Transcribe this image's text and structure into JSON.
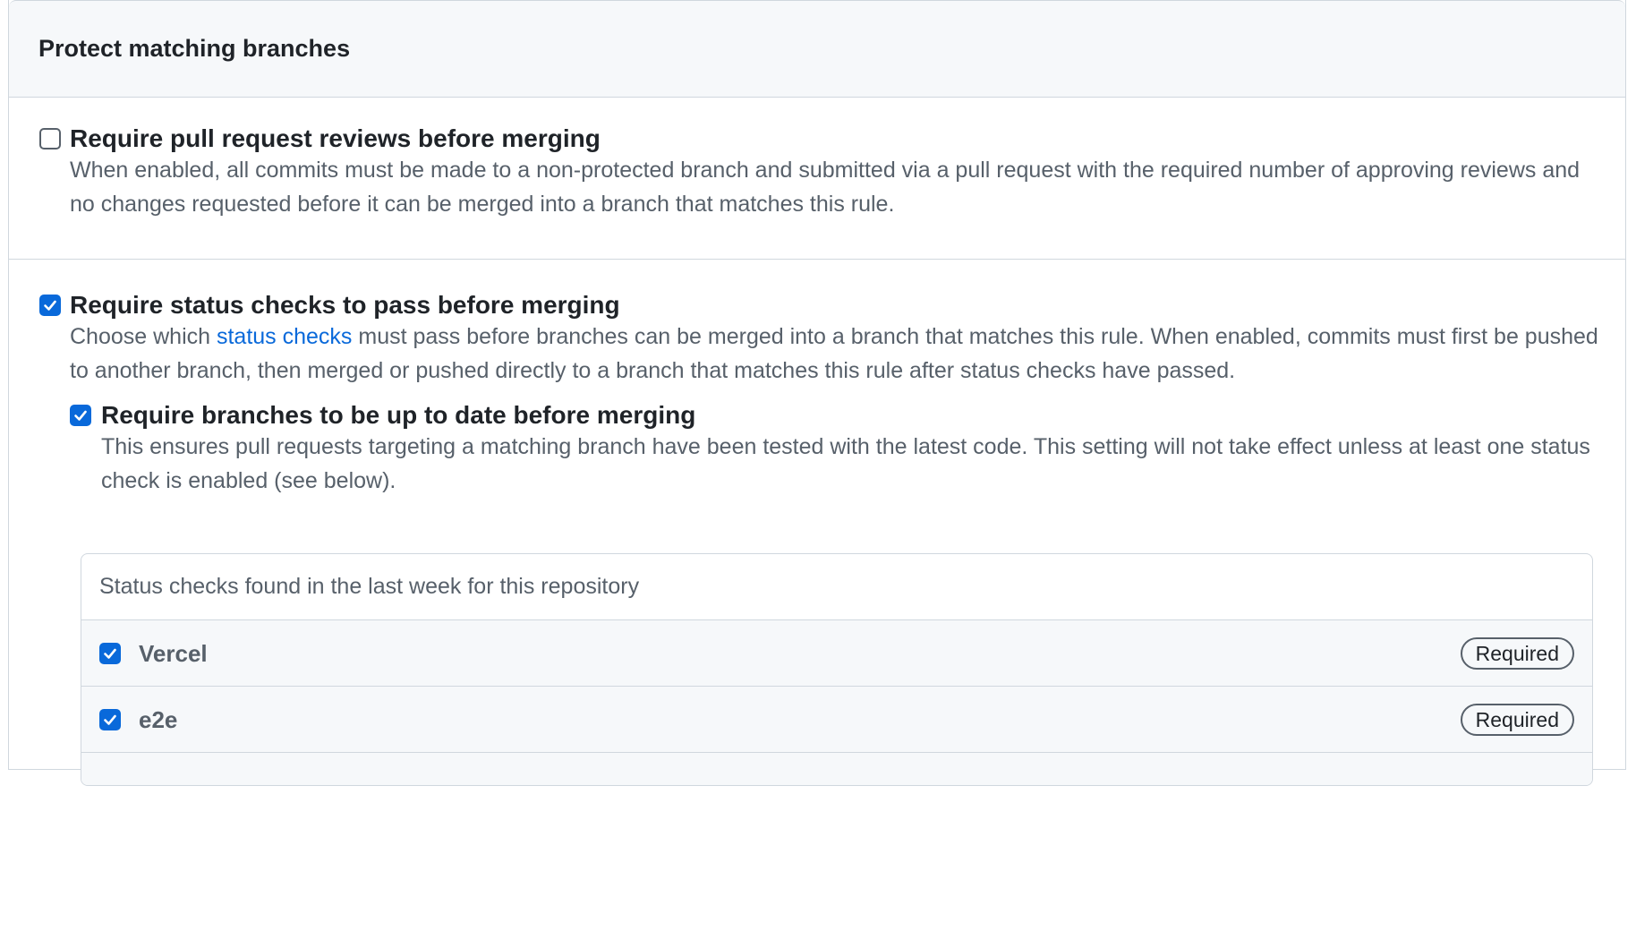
{
  "header": {
    "title": "Protect matching branches"
  },
  "options": {
    "pr_reviews": {
      "title": "Require pull request reviews before merging",
      "description": "When enabled, all commits must be made to a non-protected branch and submitted via a pull request with the required number of approving reviews and no changes requested before it can be merged into a branch that matches this rule.",
      "checked": false
    },
    "status_checks": {
      "title": "Require status checks to pass before merging",
      "desc_prefix": "Choose which ",
      "desc_link": "status checks",
      "desc_suffix": " must pass before branches can be merged into a branch that matches this rule. When enabled, commits must first be pushed to another branch, then merged or pushed directly to a branch that matches this rule after status checks have passed.",
      "checked": true
    },
    "up_to_date": {
      "title": "Require branches to be up to date before merging",
      "description": "This ensures pull requests targeting a matching branch have been tested with the latest code. This setting will not take effect unless at least one status check is enabled (see below).",
      "checked": true
    }
  },
  "status_checks_list": {
    "header": "Status checks found in the last week for this repository",
    "items": [
      {
        "name": "Vercel",
        "badge": "Required",
        "checked": true
      },
      {
        "name": "e2e",
        "badge": "Required",
        "checked": true
      }
    ]
  },
  "colors": {
    "accent": "#0969da",
    "border": "#d0d7de",
    "muted_text": "#57606a",
    "header_bg": "#f6f8fa"
  }
}
